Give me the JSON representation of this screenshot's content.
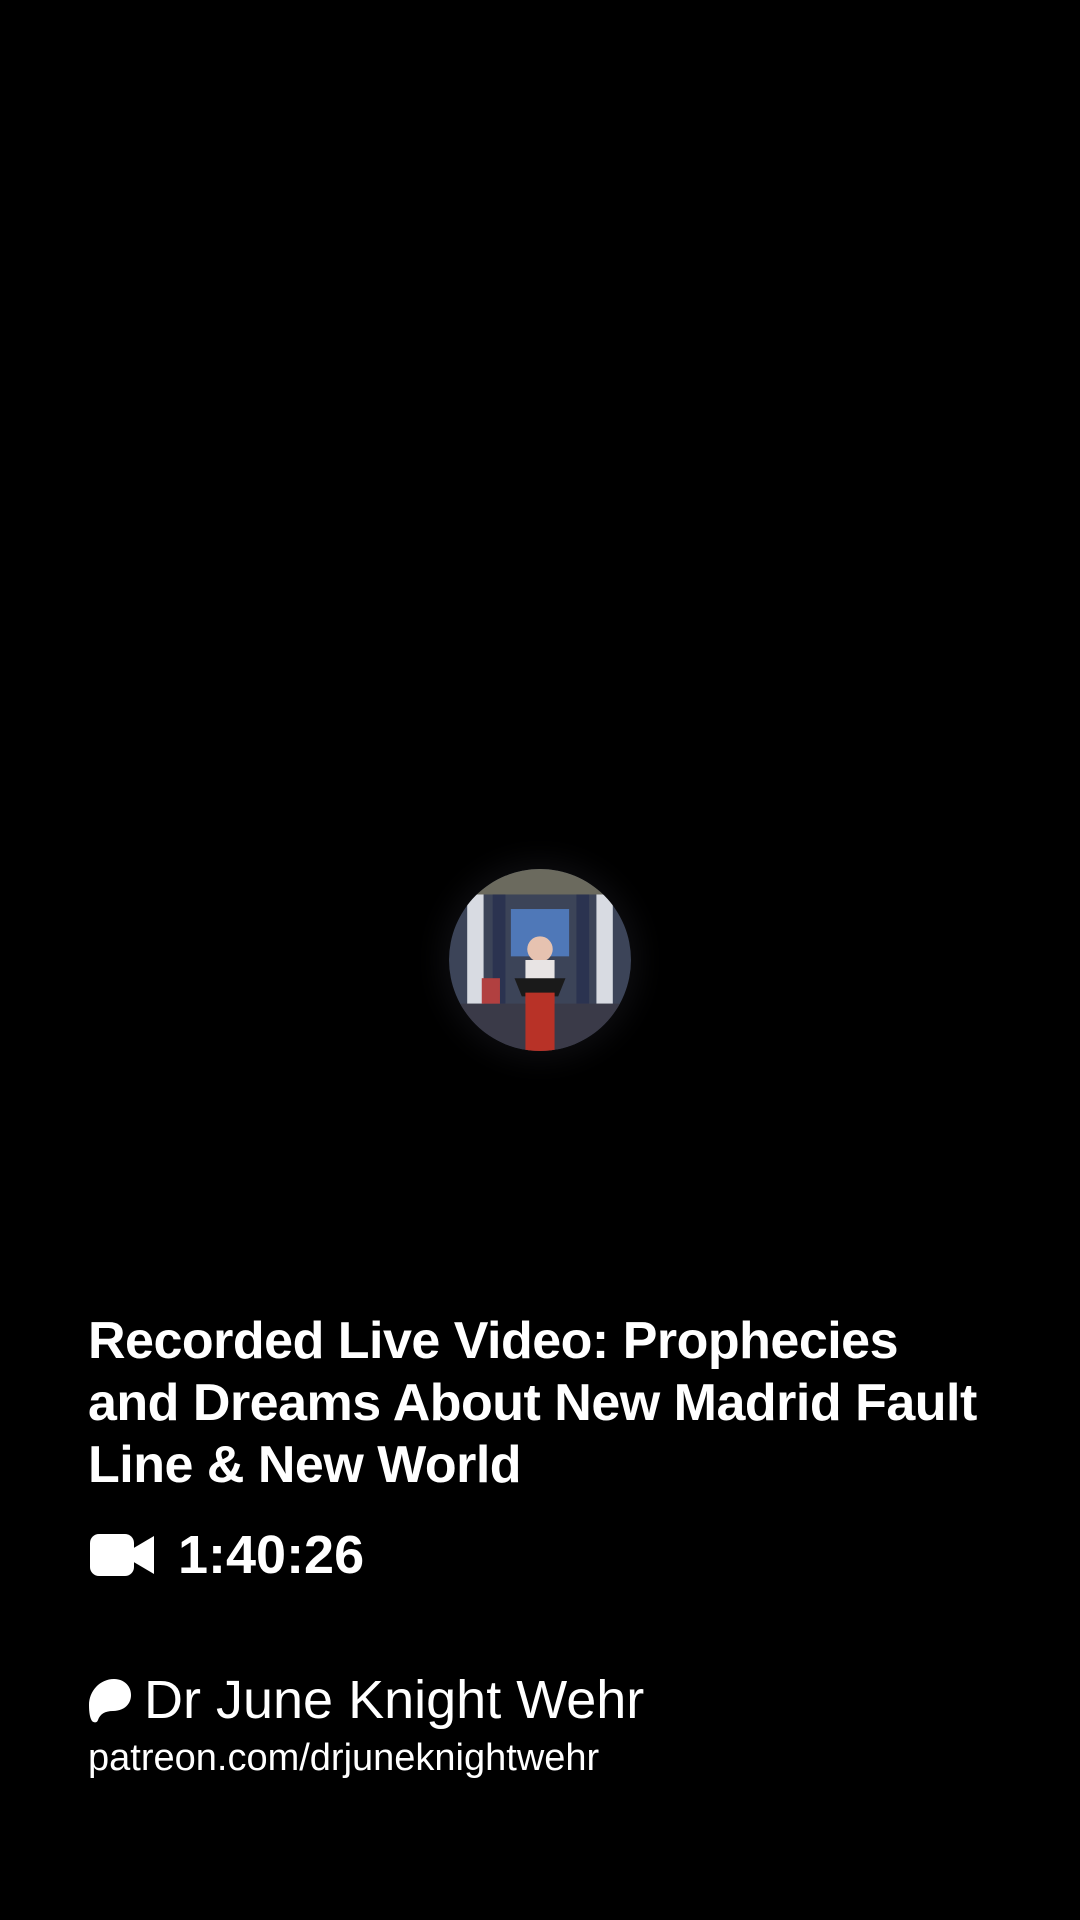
{
  "post": {
    "title": "Recorded Live Video: Prophecies and Dreams About New Madrid Fault Line & New World",
    "duration": "1:40:26",
    "media_icon": "video-camera-icon"
  },
  "creator": {
    "name": "Dr June Knight Wehr",
    "url": "patreon.com/drjuneknightwehr",
    "brand_icon": "patreon-logo-icon"
  },
  "theme": {
    "background": "#000000",
    "text": "#ffffff"
  }
}
